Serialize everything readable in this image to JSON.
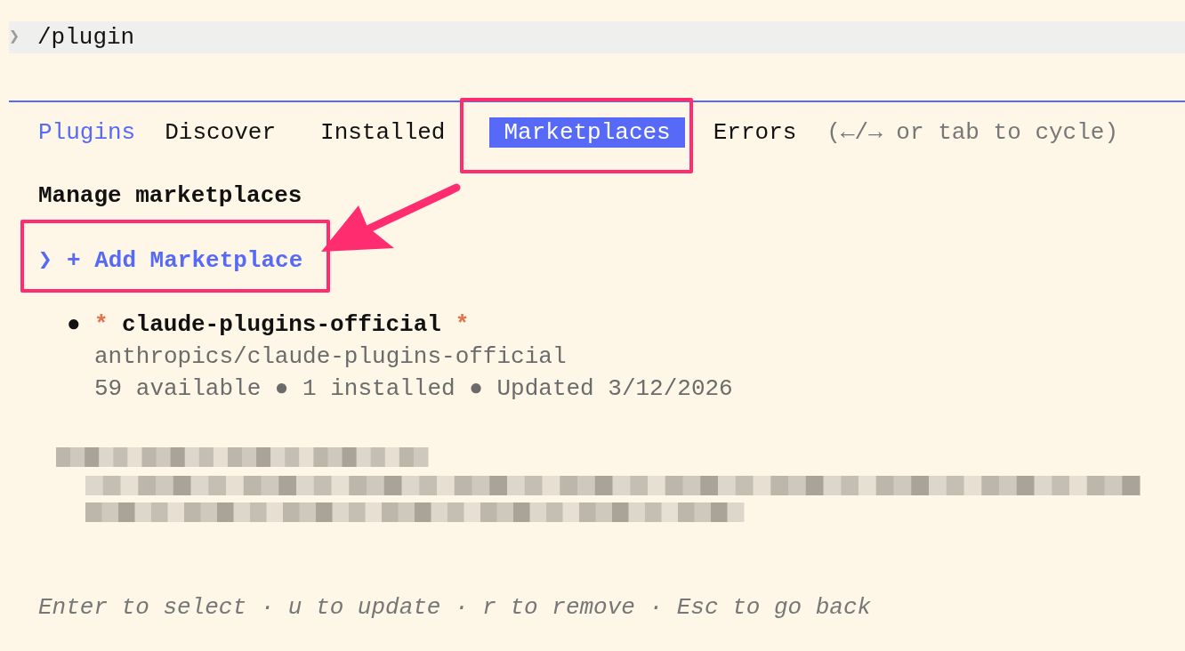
{
  "command": {
    "prompt": "❯",
    "text": "/plugin"
  },
  "header": {
    "title": "Plugins"
  },
  "tabs": [
    {
      "label": "Discover",
      "selected": false
    },
    {
      "label": "Installed",
      "selected": false
    },
    {
      "label": "Marketplaces",
      "selected": true
    },
    {
      "label": "Errors",
      "selected": false
    }
  ],
  "tabs_hint": "(←/→ or tab to cycle)",
  "section_title": "Manage marketplaces",
  "items": [
    {
      "kind": "action",
      "cursor": "❯",
      "label": "+ Add Marketplace",
      "selected": true
    },
    {
      "kind": "marketplace",
      "bullet": "●",
      "marker": "*",
      "name": "claude-plugins-official",
      "marker_end": "*",
      "source": "anthropics/claude-plugins-official",
      "stats": "59 available ● 1 installed ● Updated 3/12/2026",
      "selected": false
    },
    {
      "kind": "redacted"
    }
  ],
  "footer": "Enter to select · u to update · r to remove · Esc to go back"
}
